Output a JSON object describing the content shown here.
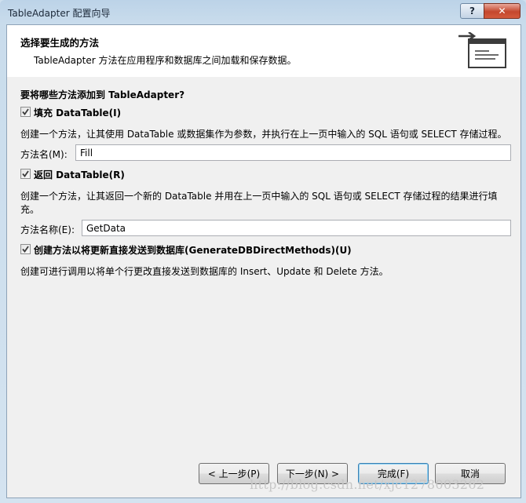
{
  "window": {
    "title": "TableAdapter 配置向导",
    "help_label": "?",
    "close_label": "✕"
  },
  "header": {
    "title": "选择要生成的方法",
    "subtitle": "TableAdapter 方法在应用程序和数据库之间加载和保存数据。",
    "icon": "wizard-header-icon"
  },
  "question": "要将哪些方法添加到 TableAdapter?",
  "fill": {
    "checkbox_label": "填充 DataTable(I)",
    "checked": true,
    "description": "创建一个方法，让其使用 DataTable 或数据集作为参数，并执行在上一页中输入的 SQL 语句或 SELECT 存储过程。",
    "name_label": "方法名(M):",
    "name_value": "Fill"
  },
  "get": {
    "checkbox_label": "返回 DataTable(R)",
    "checked": true,
    "description_line1": "创建一个方法，让其返回一个新的 DataTable 并用在上一页中输入的 SQL 语句或 SELECT 存储过程的结果进行填",
    "description_line2": "充。",
    "name_label": "方法名称(E):",
    "name_value": "GetData"
  },
  "direct": {
    "checkbox_label": "创建方法以将更新直接发送到数据库(GenerateDBDirectMethods)(U)",
    "checked": true,
    "description": "创建可进行调用以将单个行更改直接发送到数据库的 Insert、Update 和 Delete 方法。"
  },
  "buttons": {
    "prev": "< 上一步(P)",
    "next": "下一步(N) >",
    "finish": "完成(F)",
    "cancel": "取消"
  },
  "watermark": "http://blog.csdn.net/xjc1278003262"
}
